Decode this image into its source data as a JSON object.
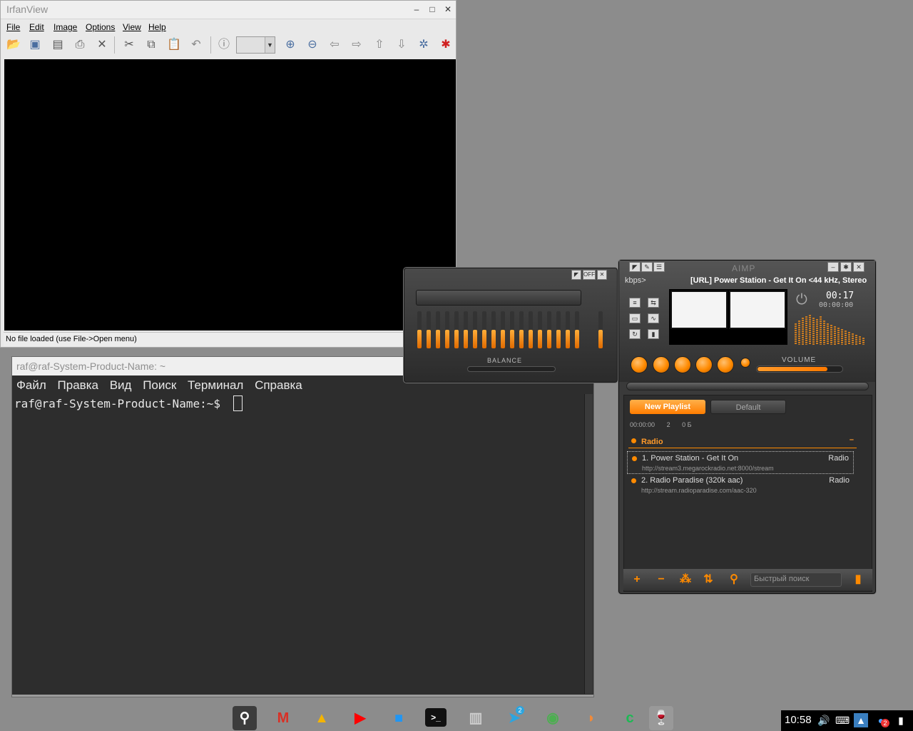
{
  "irfanview": {
    "title": "IrfanView",
    "menu": [
      "File",
      "Edit",
      "Image",
      "Options",
      "View",
      "Help"
    ],
    "status": "No file loaded (use File->Open menu)"
  },
  "terminal": {
    "title": "raf@raf-System-Product-Name: ~",
    "menu": [
      "Файл",
      "Правка",
      "Вид",
      "Поиск",
      "Терминал",
      "Справка"
    ],
    "prompt": "raf@raf-System-Product-Name:~$"
  },
  "equalizer": {
    "off_label": "OFF",
    "balance_label": "BALANCE"
  },
  "aimp": {
    "title": "AIMP",
    "kbps": "kbps>",
    "now_playing": "[URL] Power Station - Get It On <44 kHz, Stereo",
    "time": "00:17",
    "time_total": "00:00:00",
    "volume_label": "VOLUME",
    "volume_level": 0.8,
    "tabs": [
      "New Playlist",
      "Default"
    ],
    "stats": {
      "duration": "00:00:00",
      "count": "2",
      "size": "0 Б"
    },
    "group": "Radio",
    "tracks": [
      {
        "title": "1. Power Station - Get It On",
        "url": "http://stream3.megarockradio.net:8000/stream",
        "genre": "Radio"
      },
      {
        "title": "2. Radio Paradise (320k aac)",
        "url": "http://stream.radioparadise.com/aac-320",
        "genre": "Radio"
      }
    ],
    "search_placeholder": "Быстрый поиск"
  },
  "taskbar": {
    "apps": [
      "search-icon",
      "gmail-icon",
      "drive-icon",
      "youtube-icon",
      "files-icon",
      "terminal-icon",
      "trash-icon",
      "telegram-icon",
      "chrome-icon",
      "app-icon",
      "clipgrab-icon",
      "wine-icon"
    ],
    "telegram_badge": "2",
    "clock": "10:58",
    "notification_badge": "2"
  },
  "colors": {
    "accent": "#ff8a00",
    "desktop": "#8c8c8c"
  }
}
